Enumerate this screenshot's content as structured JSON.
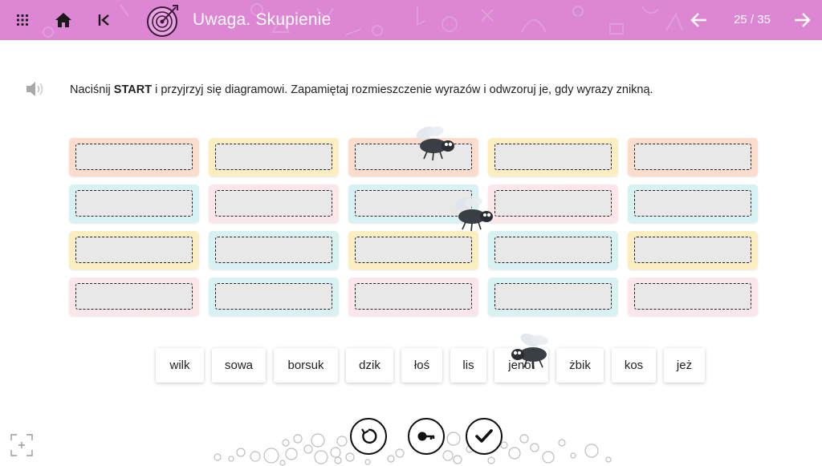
{
  "header": {
    "title": "Uwaga. Skupienie",
    "pager": "25 / 35",
    "icons": [
      "grid-menu-icon",
      "home-icon",
      "skip-back-icon",
      "target-icon",
      "arrow-left-icon",
      "arrow-right-icon"
    ],
    "color": "#dc86d4"
  },
  "instruction": {
    "before": "Naciśnij ",
    "bold": "START",
    "after": " i przyjrzyj się diagramowi. Zapamiętaj rozmieszczenie wyrazów i odwzoruj je, gdy wyrazy znikną."
  },
  "grid": {
    "rows": 4,
    "cols": 5,
    "cell_colors": [
      [
        "#fcdccc",
        "#fbefc2",
        "#fcdccc",
        "#fbefc2",
        "#fcdccc"
      ],
      [
        "#d8f1f2",
        "#fbe7ea",
        "#d8f1f2",
        "#fbe7ea",
        "#d8f1f2"
      ],
      [
        "#fbefc2",
        "#d8f1f2",
        "#fbefc2",
        "#d8f1f2",
        "#fbefc2"
      ],
      [
        "#fbe7ea",
        "#d8f1f2",
        "#fbe7ea",
        "#d8f1f2",
        "#fbe7ea"
      ]
    ]
  },
  "words": [
    "wilk",
    "sowa",
    "borsuk",
    "dzik",
    "łoś",
    "lis",
    "jenot",
    "żbik",
    "kos",
    "jeż"
  ],
  "controls": {
    "icons": [
      "reset-icon",
      "key-icon",
      "check-icon"
    ]
  }
}
